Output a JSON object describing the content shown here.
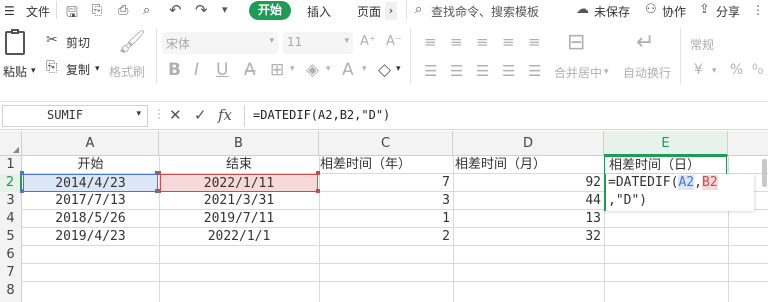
{
  "menubar": {
    "file_label": "文件",
    "start_tab": "开始",
    "insert_tab": "插入",
    "page_tab": "页面",
    "search_placeholder": "查找命令、搜索模板",
    "unsaved_label": "未保存",
    "collab_label": "协作",
    "share_label": "分享"
  },
  "ribbon": {
    "paste_label": "粘贴",
    "cut_label": "剪切",
    "copy_label": "复制",
    "format_painter_label": "格式刷",
    "font_name": "宋体",
    "font_size": "11",
    "merge_label": "合并居中",
    "wrap_label": "自动换行",
    "number_format": "常规",
    "currency_symbol": "¥",
    "percent_symbol": "%"
  },
  "formula_bar": {
    "name_box": "SUMIF",
    "fx_label": "fx",
    "formula": "=DATEDIF(A2,B2,\"D\")"
  },
  "sheet": {
    "columns": [
      "A",
      "B",
      "C",
      "D",
      "E"
    ],
    "rows": [
      "1",
      "2",
      "3",
      "4",
      "5",
      "6",
      "7",
      "8"
    ],
    "headers": [
      "开始",
      "结束",
      "相差时间（年）",
      "相差时间（月）",
      "相差时间（日）"
    ],
    "data": [
      {
        "start": "2014/4/23",
        "end": "2022/1/11",
        "years": "7",
        "months": "92"
      },
      {
        "start": "2017/7/13",
        "end": "2021/3/31",
        "years": "3",
        "months": "44"
      },
      {
        "start": "2018/5/26",
        "end": "2019/7/11",
        "years": "1",
        "months": "13"
      },
      {
        "start": "2019/4/23",
        "end": "2022/1/1",
        "years": "2",
        "months": "32"
      }
    ],
    "edit_cell": {
      "prefix": "=DATEDIF(",
      "ref_a": "A2",
      "sep": ",",
      "ref_b": "B2",
      "line2": ",\"D\")"
    },
    "active_column": "E",
    "active_row": "2"
  },
  "colors": {
    "accent_green": "#1e9b55",
    "ref_blue": "#4a78c9",
    "ref_red": "#c0504d"
  }
}
